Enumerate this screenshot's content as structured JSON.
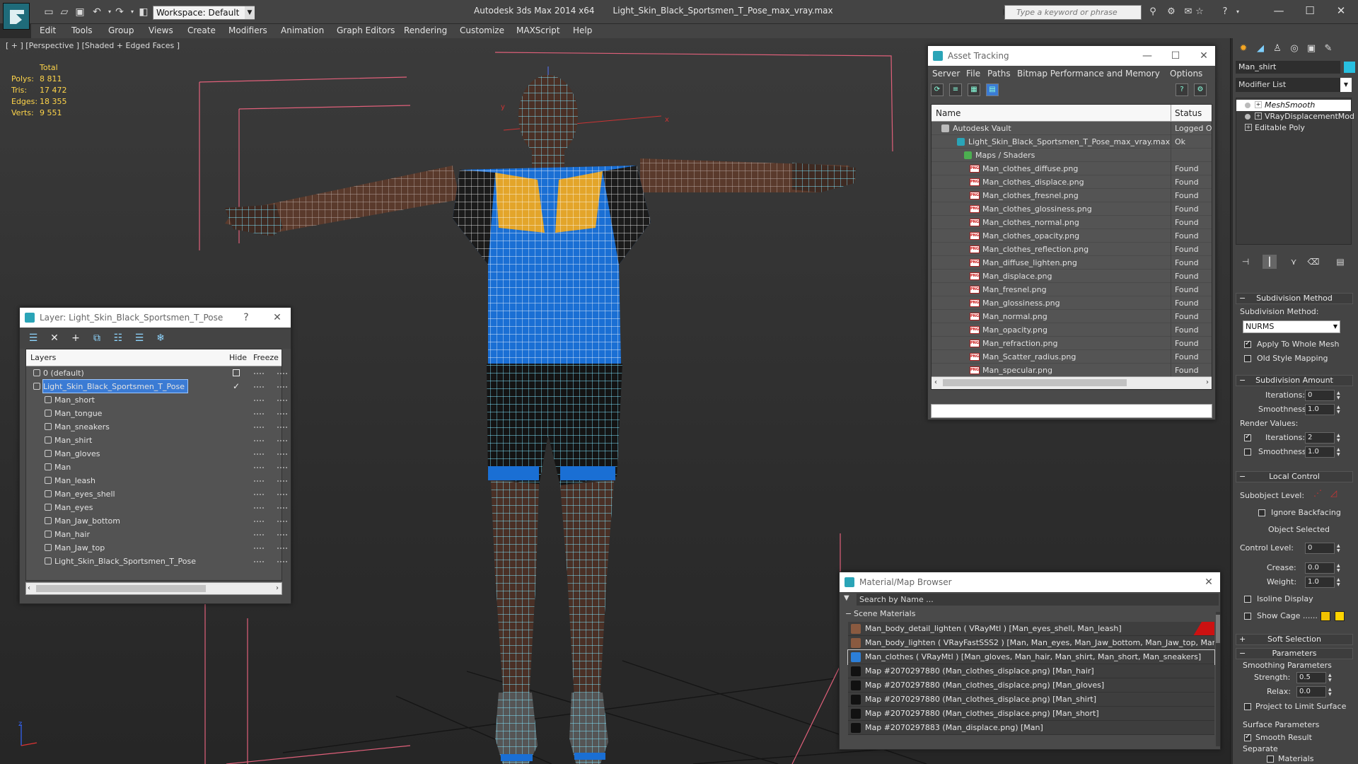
{
  "titlebar": {
    "workspace": "Workspace: Default",
    "app_title": "Autodesk 3ds Max  2014 x64",
    "file_title": "Light_Skin_Black_Sportsmen_T_Pose_max_vray.max",
    "search_placeholder": "Type a keyword or phrase",
    "minimize": "—",
    "maximize": "☐",
    "close": "✕"
  },
  "menu": [
    "Edit",
    "Tools",
    "Group",
    "Views",
    "Create",
    "Modifiers",
    "Animation",
    "Graph Editors",
    "Rendering",
    "Customize",
    "MAXScript",
    "Help"
  ],
  "viewport": {
    "label": "[ + ] [Perspective ] [Shaded + Edged Faces ]",
    "stats": {
      "header": "Total",
      "rows": [
        {
          "key": "Polys:",
          "value": "8 811"
        },
        {
          "key": "Tris:",
          "value": "17 472"
        },
        {
          "key": "Edges:",
          "value": "18 355"
        },
        {
          "key": "Verts:",
          "value": "9 551"
        }
      ]
    },
    "axis_labels": {
      "x": "x",
      "y": "y",
      "z": "z"
    }
  },
  "layer_window": {
    "title": "Layer: Light_Skin_Black_Sportsmen_T_Pose",
    "help": "?",
    "close": "✕",
    "columns": {
      "layers": "Layers",
      "hide": "Hide",
      "freeze": "Freeze"
    },
    "rows": [
      {
        "name": "0 (default)",
        "level": 0,
        "selected": false
      },
      {
        "name": "Light_Skin_Black_Sportsmen_T_Pose",
        "level": 0,
        "selected": true
      },
      {
        "name": "Man_short",
        "level": 1,
        "selected": false
      },
      {
        "name": "Man_tongue",
        "level": 1,
        "selected": false
      },
      {
        "name": "Man_sneakers",
        "level": 1,
        "selected": false
      },
      {
        "name": "Man_shirt",
        "level": 1,
        "selected": false
      },
      {
        "name": "Man_gloves",
        "level": 1,
        "selected": false
      },
      {
        "name": "Man",
        "level": 1,
        "selected": false
      },
      {
        "name": "Man_leash",
        "level": 1,
        "selected": false
      },
      {
        "name": "Man_eyes_shell",
        "level": 1,
        "selected": false
      },
      {
        "name": "Man_eyes",
        "level": 1,
        "selected": false
      },
      {
        "name": "Man_Jaw_bottom",
        "level": 1,
        "selected": false
      },
      {
        "name": "Man_hair",
        "level": 1,
        "selected": false
      },
      {
        "name": "Man_Jaw_top",
        "level": 1,
        "selected": false
      },
      {
        "name": "Light_Skin_Black_Sportsmen_T_Pose",
        "level": 1,
        "selected": false
      }
    ]
  },
  "asset_tracking": {
    "title": "Asset Tracking",
    "menu": [
      "Server",
      "File",
      "Paths",
      "Bitmap Performance and Memory",
      "Options"
    ],
    "columns": {
      "name": "Name",
      "status": "Status"
    },
    "rows": [
      {
        "name": "Autodesk Vault",
        "status": "Logged O",
        "indent": 0,
        "icon": "vault-icon"
      },
      {
        "name": "Light_Skin_Black_Sportsmen_T_Pose_max_vray.max",
        "status": "Ok",
        "indent": 1,
        "icon": "max-file-icon"
      },
      {
        "name": "Maps / Shaders",
        "status": "",
        "indent": 2,
        "icon": "maps-folder-icon"
      },
      {
        "name": "Man_clothes_diffuse.png",
        "status": "Found",
        "indent": 3,
        "icon": "png-icon"
      },
      {
        "name": "Man_clothes_displace.png",
        "status": "Found",
        "indent": 3,
        "icon": "png-icon"
      },
      {
        "name": "Man_clothes_fresnel.png",
        "status": "Found",
        "indent": 3,
        "icon": "png-icon"
      },
      {
        "name": "Man_clothes_glossiness.png",
        "status": "Found",
        "indent": 3,
        "icon": "png-icon"
      },
      {
        "name": "Man_clothes_normal.png",
        "status": "Found",
        "indent": 3,
        "icon": "png-icon"
      },
      {
        "name": "Man_clothes_opacity.png",
        "status": "Found",
        "indent": 3,
        "icon": "png-icon"
      },
      {
        "name": "Man_clothes_reflection.png",
        "status": "Found",
        "indent": 3,
        "icon": "png-icon"
      },
      {
        "name": "Man_diffuse_lighten.png",
        "status": "Found",
        "indent": 3,
        "icon": "png-icon"
      },
      {
        "name": "Man_displace.png",
        "status": "Found",
        "indent": 3,
        "icon": "png-icon"
      },
      {
        "name": "Man_fresnel.png",
        "status": "Found",
        "indent": 3,
        "icon": "png-icon"
      },
      {
        "name": "Man_glossiness.png",
        "status": "Found",
        "indent": 3,
        "icon": "png-icon"
      },
      {
        "name": "Man_normal.png",
        "status": "Found",
        "indent": 3,
        "icon": "png-icon"
      },
      {
        "name": "Man_opacity.png",
        "status": "Found",
        "indent": 3,
        "icon": "png-icon"
      },
      {
        "name": "Man_refraction.png",
        "status": "Found",
        "indent": 3,
        "icon": "png-icon"
      },
      {
        "name": "Man_Scatter_radius.png",
        "status": "Found",
        "indent": 3,
        "icon": "png-icon"
      },
      {
        "name": "Man_specular.png",
        "status": "Found",
        "indent": 3,
        "icon": "png-icon"
      }
    ]
  },
  "material_browser": {
    "title": "Material/Map Browser",
    "search_placeholder": "Search by Name ...",
    "section": "Scene Materials",
    "rows": [
      {
        "text": "Man_body_detail_lighten  ( VRayMtl ) [Man_eyes_shell, Man_leash]",
        "icon_color": "#8a5a40",
        "selected": false,
        "flag": true
      },
      {
        "text": "Man_body_lighten  ( VRayFastSSS2 ) [Man, Man_eyes, Man_Jaw_bottom, Man_Jaw_top, Man...",
        "icon_color": "#8a5a40",
        "selected": false,
        "flag": false
      },
      {
        "text": "Man_clothes  ( VRayMtl ) [Man_gloves, Man_hair, Man_shirt, Man_short, Man_sneakers]",
        "icon_color": "#2c7fd8",
        "selected": true,
        "flag": false
      },
      {
        "text": "Map #2070297880 (Man_clothes_displace.png) [Man_hair]",
        "icon_color": "#111111",
        "selected": false,
        "flag": false
      },
      {
        "text": "Map #2070297880 (Man_clothes_displace.png) [Man_gloves]",
        "icon_color": "#111111",
        "selected": false,
        "flag": false
      },
      {
        "text": "Map #2070297880 (Man_clothes_displace.png) [Man_shirt]",
        "icon_color": "#111111",
        "selected": false,
        "flag": false
      },
      {
        "text": "Map #2070297880 (Man_clothes_displace.png) [Man_short]",
        "icon_color": "#111111",
        "selected": false,
        "flag": false
      },
      {
        "text": "Map #2070297883 (Man_displace.png) [Man]",
        "icon_color": "#111111",
        "selected": false,
        "flag": false
      }
    ]
  },
  "command_panel": {
    "object_name": "Man_shirt",
    "object_color": "#28c0e0",
    "modifier_list": "Modifier List",
    "stack": [
      {
        "name": "MeshSmooth",
        "top": true
      },
      {
        "name": "VRayDisplacementMod",
        "top": false
      },
      {
        "name": "Editable Poly",
        "top": false
      }
    ],
    "subdivision_method": {
      "title": "Subdivision Method",
      "label": "Subdivision Method:",
      "value": "NURMS",
      "apply_whole_mesh": "Apply To Whole Mesh",
      "old_style": "Old Style Mapping"
    },
    "subdivision_amount": {
      "title": "Subdivision Amount",
      "iterations_label": "Iterations:",
      "iterations": "0",
      "smoothness_label": "Smoothness:",
      "smoothness": "1.0",
      "render_values": "Render Values:",
      "render_iterations_label": "Iterations:",
      "render_iterations": "2",
      "render_smoothness_label": "Smoothness:",
      "render_smoothness": "1.0"
    },
    "local_control": {
      "title": "Local Control",
      "subobject_label": "Subobject Level:",
      "ignore_backfacing": "Ignore Backfacing",
      "object_selected": "Object Selected",
      "control_level_label": "Control Level:",
      "control_level": "0",
      "crease_label": "Crease:",
      "crease": "0.0",
      "weight_label": "Weight:",
      "weight": "1.0",
      "isoline": "Isoline Display",
      "show_cage": "Show Cage ......",
      "cage_color_1": "#f2c200",
      "cage_color_2": "#ffd400"
    },
    "soft_selection": {
      "title": "Soft Selection"
    },
    "parameters": {
      "title": "Parameters",
      "smoothing_group": "Smoothing Parameters",
      "strength_label": "Strength:",
      "strength": "0.5",
      "relax_label": "Relax:",
      "relax": "0.0",
      "project_limit": "Project to Limit Surface",
      "surface_group": "Surface Parameters",
      "smooth_result": "Smooth Result",
      "separate": "Separate",
      "materials": "Materials"
    }
  }
}
